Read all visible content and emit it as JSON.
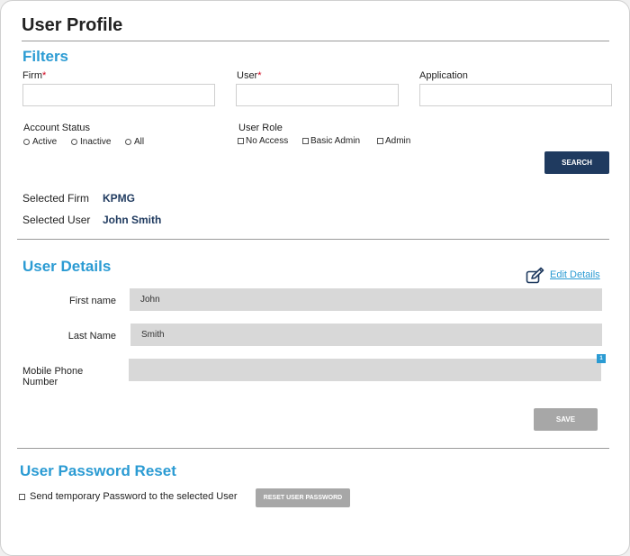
{
  "page": {
    "title": "User Profile"
  },
  "filters": {
    "heading": "Filters",
    "firm_label": "Firm",
    "user_label": "User",
    "required_mark": "*",
    "application_label": "Application",
    "firm_value": "",
    "user_value": "",
    "application_value": "",
    "account_status_label": "Account Status",
    "account_status_options": [
      "Active",
      "Inactive",
      "All"
    ],
    "user_role_label": "User Role",
    "user_role_options": [
      "No Access",
      "Basic Admin",
      "Admin"
    ],
    "search_label": "SEARCH"
  },
  "selection": {
    "firm_label": "Selected Firm",
    "firm_value": "KPMG",
    "user_label": "Selected User",
    "user_value": "John Smith"
  },
  "user_details": {
    "heading": "User Details",
    "edit_label": "Edit Details",
    "first_name_label": "First name",
    "first_name_value": "John",
    "last_name_label": "Last Name",
    "last_name_value": "Smith",
    "mobile_label": "Mobile Phone Number",
    "mobile_value": "",
    "badge_count": "1",
    "save_label": "SAVE"
  },
  "password_reset": {
    "heading": "User Password Reset",
    "checkbox_label": "Send temporary Password to the selected User",
    "reset_label": "RESET USER PASSWORD"
  },
  "colors": {
    "accent": "#2b9bd3",
    "primary_button": "#1f3a5f",
    "disabled_button": "#a7a7a7",
    "readonly_field": "#d8d8d8",
    "required": "#d0021b"
  }
}
